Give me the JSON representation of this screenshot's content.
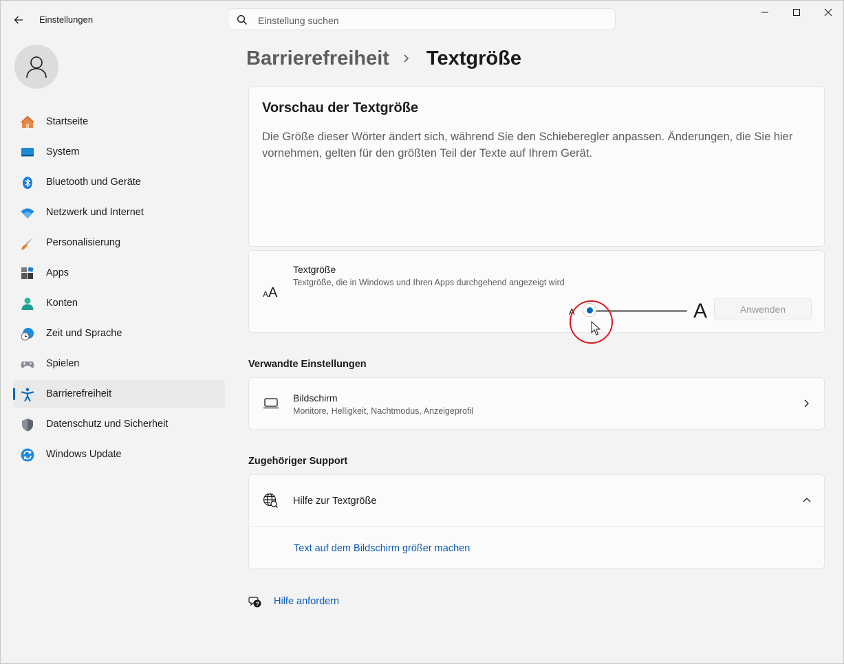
{
  "window": {
    "title": "Einstellungen",
    "controls": [
      "minimize",
      "maximize",
      "close"
    ]
  },
  "search": {
    "placeholder": "Einstellung suchen",
    "icon": "search-icon"
  },
  "sidebar": {
    "items": [
      {
        "label": "Startseite",
        "icon": "home-icon"
      },
      {
        "label": "System",
        "icon": "monitor-icon"
      },
      {
        "label": "Bluetooth und Geräte",
        "icon": "bluetooth-icon"
      },
      {
        "label": "Netzwerk und Internet",
        "icon": "wifi-icon"
      },
      {
        "label": "Personalisierung",
        "icon": "brush-icon"
      },
      {
        "label": "Apps",
        "icon": "apps-icon"
      },
      {
        "label": "Konten",
        "icon": "person-icon"
      },
      {
        "label": "Zeit und Sprache",
        "icon": "globe-clock-icon"
      },
      {
        "label": "Spielen",
        "icon": "gamepad-icon"
      },
      {
        "label": "Barrierefreiheit",
        "icon": "accessibility-icon",
        "active": true
      },
      {
        "label": "Datenschutz und Sicherheit",
        "icon": "shield-icon"
      },
      {
        "label": "Windows Update",
        "icon": "update-icon"
      }
    ]
  },
  "breadcrumb": {
    "parent": "Barrierefreiheit",
    "current": "Textgröße"
  },
  "preview": {
    "title": "Vorschau der Textgröße",
    "text": "Die Größe dieser Wörter ändert sich, während Sie den Schieberegler anpassen. Änderungen, die Sie hier vornehmen, gelten für den größten Teil der Texte auf Ihrem Gerät."
  },
  "textsize": {
    "title": "Textgröße",
    "description": "Textgröße, die in Windows und Ihren Apps durchgehend angezeigt wird",
    "small_label": "A",
    "large_label": "A",
    "slider_value": 0,
    "apply_label": "Anwenden"
  },
  "related": {
    "heading": "Verwandte Einstellungen",
    "display": {
      "title": "Bildschirm",
      "description": "Monitore, Helligkeit, Nachtmodus, Anzeigeprofil"
    }
  },
  "support": {
    "heading": "Zugehöriger Support",
    "title": "Hilfe zur Textgröße",
    "link": "Text auf dem Bildschirm größer machen"
  },
  "help": {
    "label": "Hilfe anfordern"
  },
  "colors": {
    "accent": "#0067c0",
    "link": "#0b5bb5",
    "highlight_ring": "#e0141e"
  }
}
